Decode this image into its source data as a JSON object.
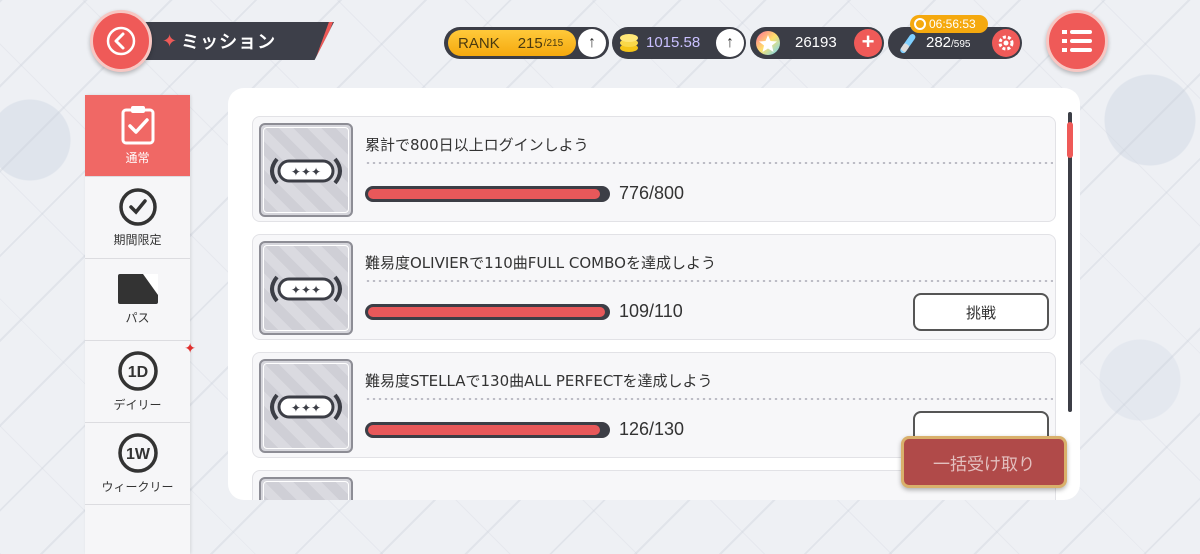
{
  "header": {
    "title": "ミッション",
    "rank_label": "RANK",
    "rank_value": "215",
    "rank_max": "/215",
    "gold_value": "1015.58",
    "star_value": "26193",
    "stamina_value": "282",
    "stamina_max": "/595",
    "timer": "06:56:53"
  },
  "sidebar": {
    "items": [
      {
        "label": "通常",
        "icon": "checklist-icon",
        "active": true
      },
      {
        "label": "期間限定",
        "icon": "clock-icon",
        "active": false
      },
      {
        "label": "パス",
        "icon": "pass-card-icon",
        "active": false
      },
      {
        "label": "デイリー",
        "icon": "daily-1d-icon",
        "icon_text": "1D",
        "active": false,
        "badge": true
      },
      {
        "label": "ウィークリー",
        "icon": "weekly-1w-icon",
        "icon_text": "1W",
        "active": false
      }
    ]
  },
  "missions": [
    {
      "title": "累計で800日以上ログインしよう",
      "progress": "776/800",
      "fraction": 0.97,
      "button": ""
    },
    {
      "title": "難易度OLIVIERで110曲FULL COMBOを達成しよう",
      "progress": "109/110",
      "fraction": 0.99,
      "button": "挑戦"
    },
    {
      "title": "難易度STELLAで130曲ALL PERFECTを達成しよう",
      "progress": "126/130",
      "fraction": 0.97,
      "button": ""
    }
  ],
  "bulk_button": "一括受け取り",
  "colors": {
    "accent": "#ef5a58",
    "dark": "#3c3e46",
    "gold": "#f5a90e"
  }
}
